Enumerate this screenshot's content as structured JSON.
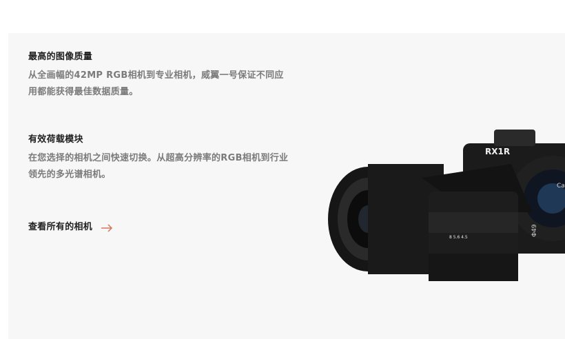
{
  "features": [
    {
      "title": "最高的图像质量",
      "description": "从全画幅的42MP RGB相机到专业相机，威翼一号保证不同应用都能获得最佳数据质量。"
    },
    {
      "title": "有效荷载模块",
      "description": "在您选择的相机之间快速切换。从超高分辨率的RGB相机到行业领先的多光谱相机。"
    }
  ],
  "cta": {
    "label": "查看所有的相机",
    "icon": "arrow-right-icon",
    "accent_color": "#d9725a"
  },
  "image": {
    "camera_badge": "RX1R",
    "lens_marking": "Φ49",
    "brand_fragment": "Carl",
    "scale_marks": "8  5.6  4.5"
  },
  "colors": {
    "panel_bg": "#f7f7f7",
    "heading": "#1f1f1f",
    "body_text": "#7b7b7b"
  }
}
